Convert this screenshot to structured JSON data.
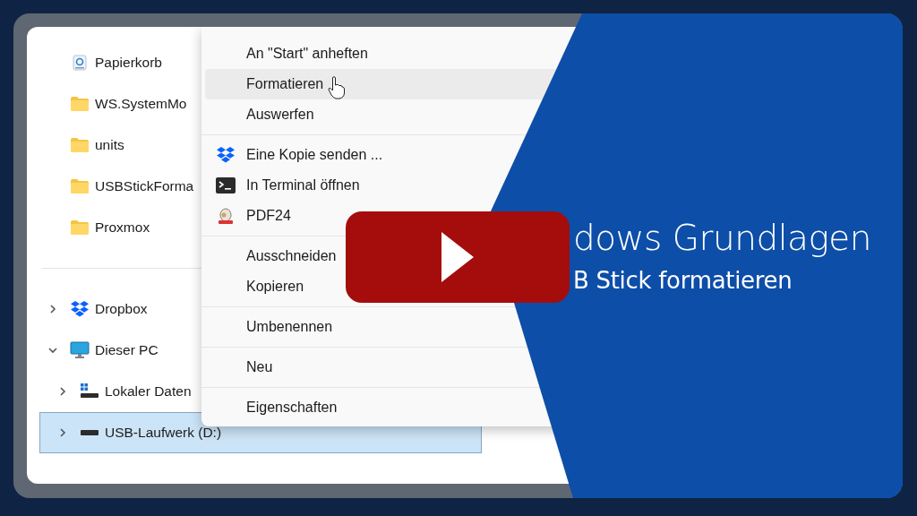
{
  "sidebar": {
    "pinned": [
      {
        "label": "Papierkorb",
        "kind": "recycle",
        "selected": false
      },
      {
        "label": "WS.SystemMo",
        "kind": "folder",
        "selected": false
      },
      {
        "label": "units",
        "kind": "folder",
        "selected": false
      },
      {
        "label": "USBStickForma",
        "kind": "folder",
        "selected": false
      },
      {
        "label": "Proxmox",
        "kind": "folder",
        "selected": false
      }
    ],
    "tree": [
      {
        "label": "Dropbox",
        "kind": "dropbox",
        "expanded": false,
        "selected": false
      },
      {
        "label": "Dieser PC",
        "kind": "pc",
        "expanded": true,
        "selected": false,
        "children": [
          {
            "label": "Lokaler Daten",
            "kind": "system-drive",
            "expanded": false,
            "selected": false
          },
          {
            "label": "USB-Laufwerk (D:)",
            "kind": "drive",
            "expanded": false,
            "selected": true
          }
        ]
      }
    ]
  },
  "context_menu": {
    "groups": [
      [
        {
          "label": "An \"Start\" anheften",
          "highlighted": false
        },
        {
          "label": "Formatieren",
          "highlighted": true
        },
        {
          "label": "Auswerfen",
          "highlighted": false
        }
      ],
      [
        {
          "label": "Eine Kopie senden ...",
          "kind": "dropbox",
          "highlighted": false
        },
        {
          "label": "In Terminal öffnen",
          "kind": "terminal",
          "highlighted": false
        },
        {
          "label": "PDF24",
          "kind": "pdf24",
          "highlighted": false
        }
      ],
      [
        {
          "label": "Ausschneiden",
          "highlighted": false
        },
        {
          "label": "Kopieren",
          "highlighted": false
        }
      ],
      [
        {
          "label": "Umbenennen",
          "highlighted": false
        }
      ],
      [
        {
          "label": "Neu",
          "highlighted": false
        }
      ],
      [
        {
          "label": "Eigenschaften",
          "highlighted": false
        }
      ]
    ]
  },
  "banner": {
    "title": "dows Grundlagen",
    "subtitle": "B Stick formatieren"
  }
}
